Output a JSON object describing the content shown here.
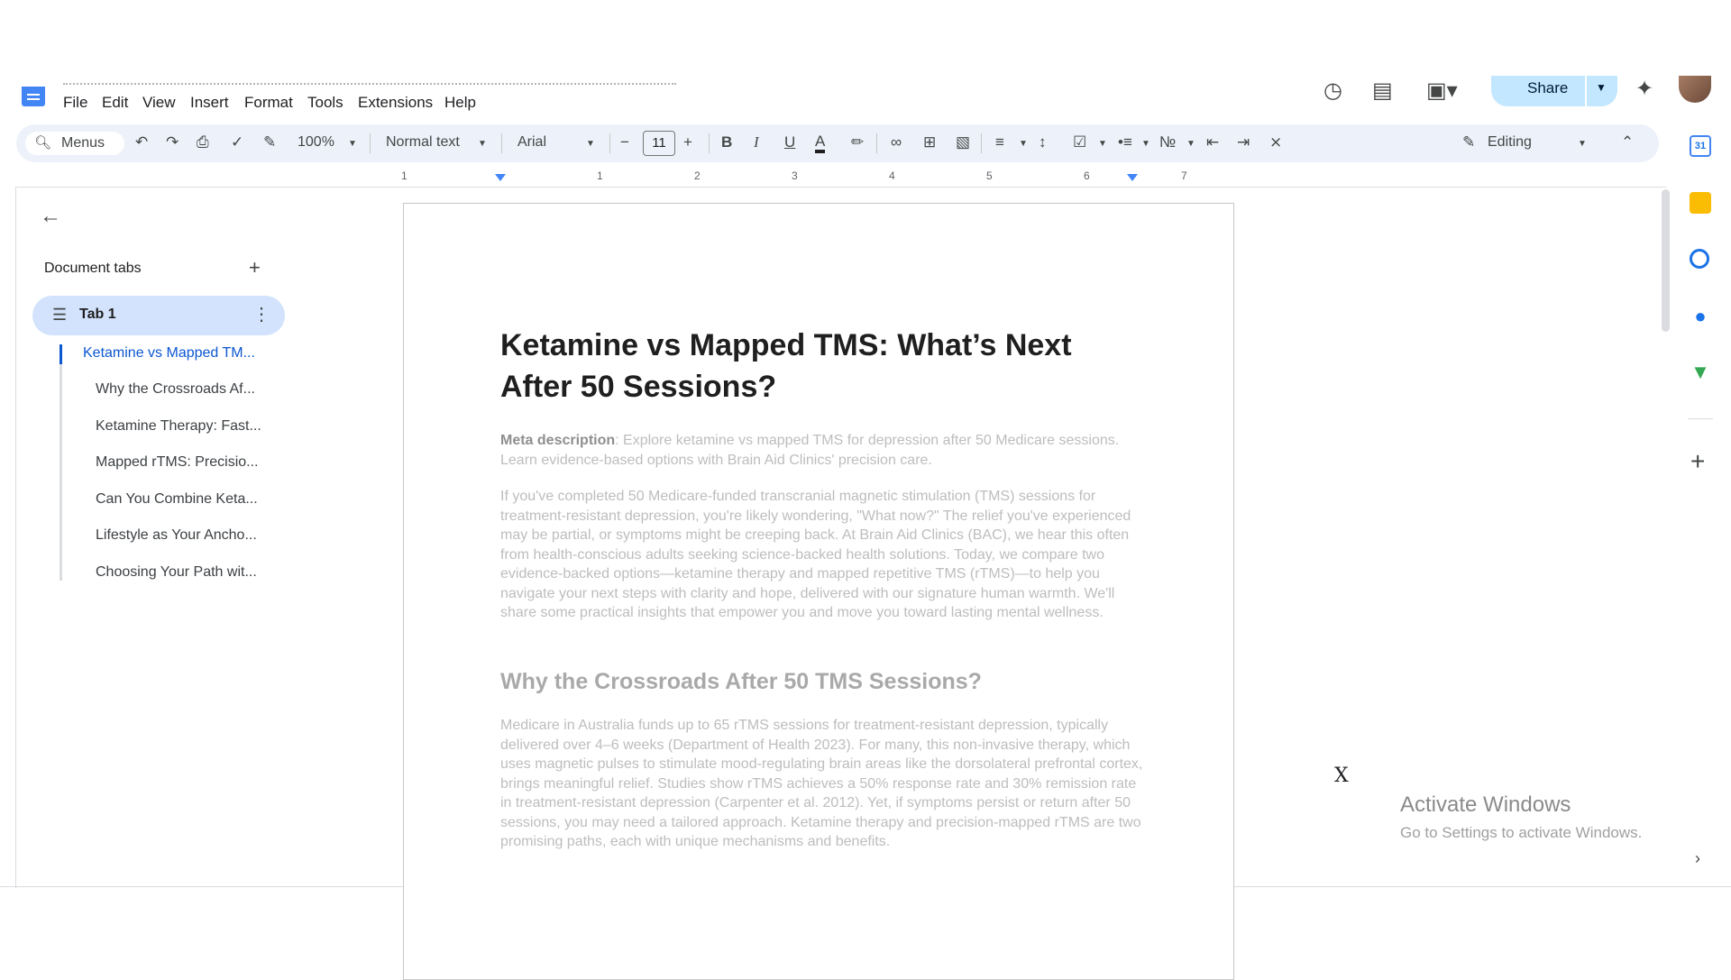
{
  "menu": {
    "items": [
      "File",
      "Edit",
      "View",
      "Insert",
      "Format",
      "Tools",
      "Extensions",
      "Help"
    ]
  },
  "header": {
    "share_label": "Share",
    "icons": [
      "history-icon",
      "comment-icon",
      "meet-icon",
      "gemini-icon",
      "avatar"
    ]
  },
  "toolbar": {
    "search_label": "Menus",
    "zoom": "100%",
    "style": "Normal text",
    "font": "Arial",
    "font_size": "11",
    "mode": "Editing"
  },
  "ruler": {
    "labels": [
      "1",
      "1",
      "2",
      "3",
      "4",
      "5",
      "6",
      "7"
    ]
  },
  "sidebar": {
    "title": "Document tabs",
    "tab_label": "Tab 1",
    "outline": [
      "Ketamine vs Mapped TM...",
      "Why the Crossroads Af...",
      "Ketamine Therapy: Fast...",
      "Mapped rTMS: Precisio...",
      "Can You Combine Keta...",
      "Lifestyle as Your Ancho...",
      "Choosing Your Path wit..."
    ]
  },
  "document": {
    "title_line1": "Ketamine vs Mapped TMS: What’s Next",
    "title_line2": "After 50 Sessions?",
    "meta_label": "Meta description",
    "meta_text": ": Explore ketamine vs mapped TMS for depression after 50 Medicare sessions. Learn evidence-based options with Brain Aid Clinics' precision care.",
    "para1": "If you've completed 50 Medicare-funded transcranial magnetic stimulation (TMS) sessions for treatment-resistant depression, you're likely wondering, \"What now?\" The relief you've experienced may be partial, or symptoms might be creeping back. At Brain Aid Clinics (BAC), we hear this often from health-conscious adults seeking science-backed health solutions. Today, we compare two evidence-backed options—ketamine therapy and mapped repetitive TMS (rTMS)—to help you navigate your next steps with clarity and hope, delivered with our signature human warmth. We'll share some practical insights that empower you and move you toward lasting mental wellness.",
    "heading2": "Why the Crossroads After 50 TMS Sessions?",
    "para2": "Medicare in Australia funds up to 65 rTMS sessions for treatment-resistant depression, typically delivered over 4–6 weeks (Department of Health 2023). For many, this non-invasive therapy, which uses magnetic pulses to stimulate mood-regulating brain areas like the dorsolateral prefrontal cortex, brings meaningful relief. Studies show rTMS achieves a 50% response rate and 30% remission rate in treatment-resistant depression (Carpenter et al. 2012). Yet, if symptoms persist or return after 50 sessions, you may need a tailored approach. Ketamine therapy and precision-mapped rTMS are two promising paths, each with unique mechanisms and benefits."
  },
  "overlay": {
    "close_label": "X",
    "activate_title": "Activate Windows",
    "activate_sub": "Go to Settings to activate Windows."
  },
  "side_panel": {
    "icons": [
      "calendar-icon",
      "keep-icon",
      "tasks-icon",
      "contacts-icon",
      "maps-icon",
      "add-icon"
    ],
    "calendar_day": "31"
  }
}
